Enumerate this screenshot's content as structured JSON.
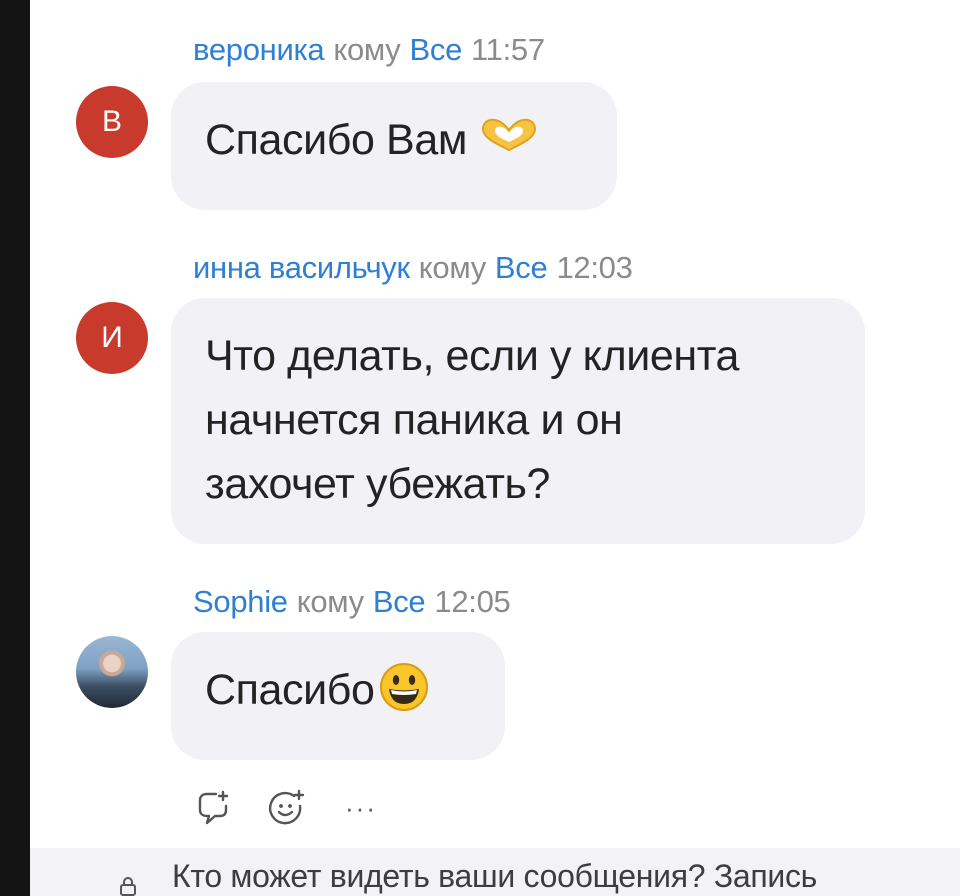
{
  "messages": [
    {
      "sender": "вероника",
      "to_word": "кому",
      "recipient": "Все",
      "time": "11:57",
      "avatar_letter": "В",
      "avatar_color": "#c83a2b",
      "lines": [
        "Спасибо Вам"
      ],
      "emoji": "heart-hands-emoji"
    },
    {
      "sender": "инна васильчук",
      "to_word": "кому",
      "recipient": "Все",
      "time": "12:03",
      "avatar_letter": "И",
      "avatar_color": "#c83a2b",
      "lines": [
        "Что делать, если у клиента",
        "начнется паника и он",
        "захочет убежать?"
      ]
    },
    {
      "sender": "Sophie",
      "to_word": "кому",
      "recipient": "Все",
      "time": "12:05",
      "avatar": "photo",
      "lines": [
        "Спасибо"
      ],
      "emoji": "grinning-face-emoji"
    }
  ],
  "actions": {
    "reply_icon": "reply-icon",
    "react_icon": "add-reaction-icon",
    "more_label": "···"
  },
  "footer": {
    "notice": "Кто может видеть ваши сообщения? Запись"
  },
  "colors": {
    "sender_link": "#2f7fd3",
    "bubble_bg": "#f1f1f6",
    "avatar_red": "#c83a2b"
  }
}
